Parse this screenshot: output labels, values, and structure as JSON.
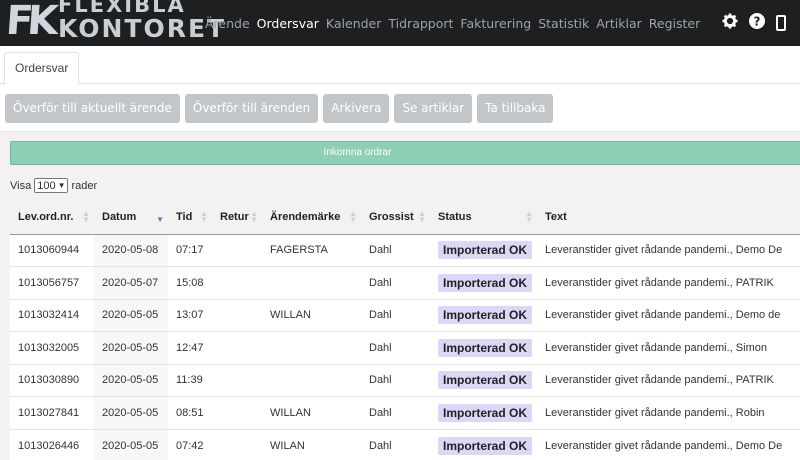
{
  "app": {
    "logo_line1": "FLEXIBLA",
    "logo_line2": "KONTORET",
    "logo_mark": "FK"
  },
  "nav": {
    "items": [
      "Ärende",
      "Ordersvar",
      "Kalender",
      "Tidrapport",
      "Fakturering",
      "Statistik",
      "Artiklar",
      "Register"
    ],
    "active": "Ordersvar",
    "icons": [
      "gear-icon",
      "help-icon",
      "mobile-icon"
    ]
  },
  "tabs": [
    "Ordersvar"
  ],
  "actions": [
    "Överför till aktuellt ärende",
    "Överför till ärenden",
    "Arkivera",
    "Se artiklar",
    "Ta tillbaka"
  ],
  "banner": "Inkomna ordrar",
  "length_menu": {
    "prefix": "Visa",
    "value": "100",
    "suffix": "rader"
  },
  "table": {
    "columns": [
      "Lev.ord.nr.",
      "Datum",
      "Tid",
      "Retur",
      "Ärendemärke",
      "Grossist",
      "Status",
      "Text"
    ],
    "sorted_column": "Datum",
    "rows": [
      [
        "1013060944",
        "2020-05-08",
        "07:17",
        "",
        "FAGERSTA",
        "Dahl",
        "Importerad OK",
        "Leveranstider givet rådande pandemi., Demo De"
      ],
      [
        "1013056757",
        "2020-05-07",
        "15:08",
        "",
        "",
        "Dahl",
        "Importerad OK",
        "Leveranstider givet rådande pandemi., PATRIK"
      ],
      [
        "1013032414",
        "2020-05-05",
        "13:07",
        "",
        "WILLAN",
        "Dahl",
        "Importerad OK",
        "Leveranstider givet rådande pandemi., Demo de"
      ],
      [
        "1013032005",
        "2020-05-05",
        "12:47",
        "",
        "",
        "Dahl",
        "Importerad OK",
        "Leveranstider givet rådande pandemi., Simon"
      ],
      [
        "1013030890",
        "2020-05-05",
        "11:39",
        "",
        "",
        "Dahl",
        "Importerad OK",
        "Leveranstider givet rådande pandemi., PATRIK"
      ],
      [
        "1013027841",
        "2020-05-05",
        "08:51",
        "",
        "WILLAN",
        "Dahl",
        "Importerad OK",
        "Leveranstider givet rådande pandemi., Robin"
      ],
      [
        "1013026446",
        "2020-05-05",
        "07:42",
        "",
        "WILAN",
        "Dahl",
        "Importerad OK",
        "Leveranstider givet rådande pandemi., Demo De"
      ]
    ]
  },
  "colors": {
    "topbar": "#1d1f21",
    "banner": "#8fcfb5",
    "badge": "#ddd6f6",
    "button": "#c3c6c9"
  }
}
